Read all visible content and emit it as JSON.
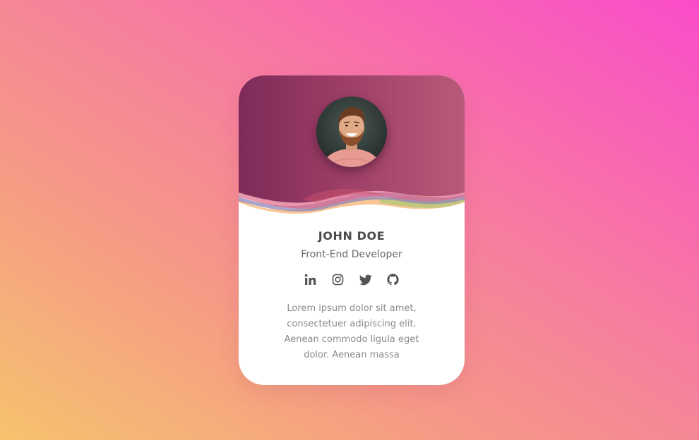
{
  "profile": {
    "name": "JOHN DOE",
    "role": "Front-End Developer",
    "bio_lines": [
      "Lorem ipsum dolor sit amet,",
      "consectetuer adipiscing elit.",
      "Aenean commodo ligula eget",
      "dolor. Aenean massa"
    ]
  },
  "socials": [
    {
      "icon": "linkedin-icon"
    },
    {
      "icon": "instagram-icon"
    },
    {
      "icon": "twitter-icon"
    },
    {
      "icon": "github-icon"
    }
  ],
  "colors": {
    "header_start": "#7e2a58",
    "header_end": "#b95a7a",
    "text_dark": "#4a4a4a",
    "text_muted": "#8a8a8a"
  }
}
